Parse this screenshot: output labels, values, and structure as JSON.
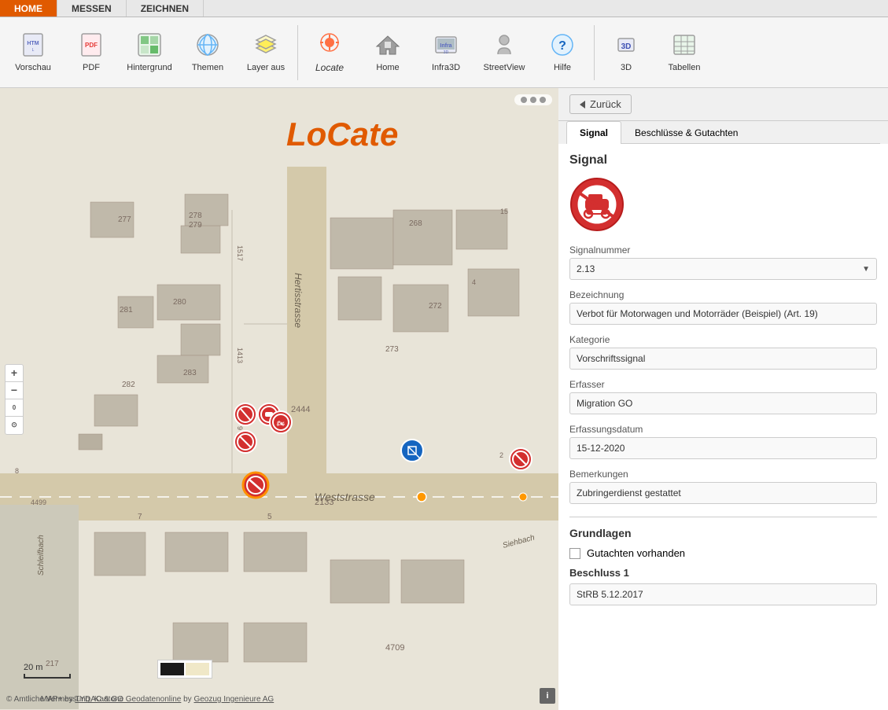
{
  "nav": {
    "items": [
      {
        "label": "HOME",
        "active": true
      },
      {
        "label": "MESSEN",
        "active": false
      },
      {
        "label": "ZEICHNEN",
        "active": false
      }
    ]
  },
  "toolbar": {
    "items": [
      {
        "label": "Vorschau",
        "icon": "html-icon"
      },
      {
        "label": "PDF",
        "icon": "pdf-icon"
      },
      {
        "label": "Hintergrund",
        "icon": "hintergrund-icon"
      },
      {
        "label": "Themen",
        "icon": "themen-icon"
      },
      {
        "label": "Layer aus",
        "icon": "layer-icon"
      },
      {
        "label": "Locate",
        "icon": "locate-icon"
      },
      {
        "label": "Home",
        "icon": "home-icon"
      },
      {
        "label": "Infra3D",
        "icon": "infra3d-icon"
      },
      {
        "label": "StreetView",
        "icon": "streetview-icon"
      },
      {
        "label": "Hilfe",
        "icon": "hilfe-icon"
      },
      {
        "label": "3D",
        "icon": "3d-icon"
      },
      {
        "label": "Tabellen",
        "icon": "tabellen-icon"
      }
    ]
  },
  "map": {
    "scale_label": "20 m",
    "copyright": "© Amtliche Vermessung,",
    "copyright_link": "Kantone",
    "attribution_pre": "MAP+ by",
    "attribution_tydac": "TYDAC",
    "attribution_mid": "&",
    "attribution_geo": "GO Geodatenonline",
    "attribution_by": "by",
    "attribution_geozug": "Geozug Ingenieure AG"
  },
  "panel": {
    "back_label": "Zurück",
    "tabs": [
      {
        "label": "Signal",
        "active": true
      },
      {
        "label": "Beschlüsse & Gutachten",
        "active": false
      }
    ],
    "section_title": "Signal",
    "fields": [
      {
        "label": "Signalnummer",
        "value": "2.13",
        "has_arrow": true
      },
      {
        "label": "Bezeichnung",
        "value": "Verbot für Motorwagen und Motorräder (Beispiel) (Art. 19)",
        "has_arrow": false
      },
      {
        "label": "Kategorie",
        "value": "Vorschriftssignal",
        "has_arrow": false
      },
      {
        "label": "Erfasser",
        "value": "Migration GO",
        "has_arrow": false
      },
      {
        "label": "Erfassungsdatum",
        "value": "15-12-2020",
        "has_arrow": false
      },
      {
        "label": "Bemerkungen",
        "value": "Zubringerdienst gestattet",
        "has_arrow": false
      }
    ],
    "grundlagen": {
      "title": "Grundlagen",
      "checkbox_label": "Gutachten vorhanden",
      "beschluss_label": "Beschluss 1",
      "beschluss_value": "StRB 5.12.2017"
    }
  }
}
